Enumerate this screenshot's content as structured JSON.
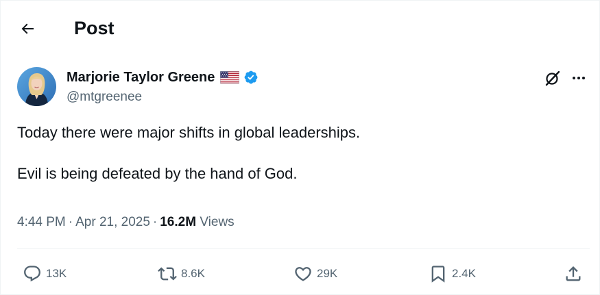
{
  "header": {
    "title": "Post",
    "back_icon": "arrow-left-icon"
  },
  "author": {
    "name": "Marjorie Taylor Greene",
    "handle": "@mtgreenee",
    "flag_icon": "us-flag-icon",
    "verified_icon": "verified-badge-icon",
    "verified_color": "#1d9bf0"
  },
  "toolbar": {
    "grok_icon": "grok-icon",
    "more_icon": "more-horizontal-icon"
  },
  "tweet": {
    "line1": "Today there were major shifts in global leaderships.",
    "line2": "Evil is being defeated by the hand of God."
  },
  "meta": {
    "time": "4:44 PM",
    "separator": "·",
    "date": "Apr 21, 2025",
    "views_count": "16.2M",
    "views_label": "Views"
  },
  "actions": {
    "replies": "13K",
    "reposts": "8.6K",
    "likes": "29K",
    "bookmarks": "2.4K"
  },
  "colors": {
    "text_primary": "#0f1419",
    "text_secondary": "#536471",
    "border": "#eff3f4",
    "accent": "#1d9bf0"
  }
}
